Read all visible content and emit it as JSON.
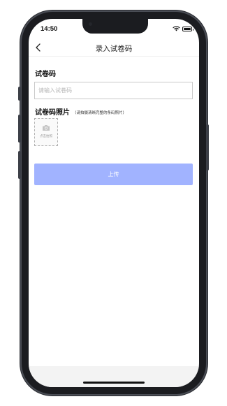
{
  "status_bar": {
    "time": "14:50"
  },
  "nav": {
    "title": "录入试卷码"
  },
  "form": {
    "code_label": "试卷码",
    "code_placeholder": "请输入试卷码",
    "code_value": "",
    "photo_label": "试卷码照片",
    "photo_hint": "（请拍摄清晰完整的条码照片）",
    "upload_label": "点击拍照",
    "submit_label": "上传"
  },
  "colors": {
    "primary_button_disabled": "#a1b3ff",
    "frame": "#1b1c20",
    "background": "#ffffff"
  },
  "icons": [
    "back-icon",
    "wifi-icon",
    "battery-icon",
    "camera-icon"
  ]
}
